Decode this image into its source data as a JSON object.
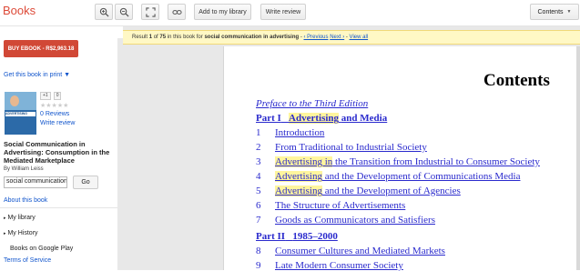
{
  "header": {
    "brand": "Books",
    "zoom_in_icon": "zoom-in-icon",
    "zoom_out_icon": "zoom-out-icon",
    "fullscreen_icon": "fullscreen-icon",
    "link_icon": "link-icon",
    "add_to_library": "Add to my library",
    "write_review": "Write review",
    "contents_label": "Contents"
  },
  "sidebar": {
    "buy_button": "BUY EBOOK - R$2,963.18",
    "get_in_print": "Get this book in print ▼",
    "gplus_label": "+1",
    "gplus_count": "0",
    "stars": "★★★★★",
    "reviews": "0 Reviews",
    "write_review": "Write review",
    "book_title": "Social Communication in Advertising: Consumption in the Mediated Marketplace",
    "author": "By William Leiss",
    "search_value": "social communication",
    "go_button": "Go",
    "about": "About this book",
    "my_library": "My library",
    "my_history": "My History",
    "books_on_play": "Books on Google Play",
    "terms": "Terms of Service"
  },
  "result": {
    "prefix": "Result",
    "index": "1",
    "of": "of",
    "total": "75",
    "middle": "in this book for",
    "query": "social communication in advertising",
    "dash": "-",
    "previous": "‹ Previous",
    "next": "Next ›",
    "dash2": "-",
    "view_all": "View all"
  },
  "page": {
    "title": "Contents",
    "preface": "Preface to the Third Edition",
    "part1_prefix": "Part I",
    "part1_hl": "Advertising",
    "part1_rest": "and Media",
    "items": [
      {
        "num": "1",
        "hl": "",
        "text": "Introduction"
      },
      {
        "num": "2",
        "hl": "",
        "text": "From Traditional to Industrial Society"
      },
      {
        "num": "3",
        "hl": "Advertising in",
        "text": " the Transition from Industrial to Consumer Society"
      },
      {
        "num": "4",
        "hl": "Advertising",
        "text": " and the Development of Communications Media"
      },
      {
        "num": "5",
        "hl": "Advertising",
        "text": " and the Development of Agencies"
      },
      {
        "num": "6",
        "hl": "",
        "text": "The Structure of Advertisements"
      },
      {
        "num": "7",
        "hl": "",
        "text": "Goods as Communicators and Satisfiers"
      }
    ],
    "part2_prefix": "Part II",
    "part2_title": "1985–2000",
    "items2": [
      {
        "num": "8",
        "text": "Consumer Cultures and Mediated Markets"
      },
      {
        "num": "9",
        "text": "Late Modern Consumer Society"
      }
    ]
  }
}
